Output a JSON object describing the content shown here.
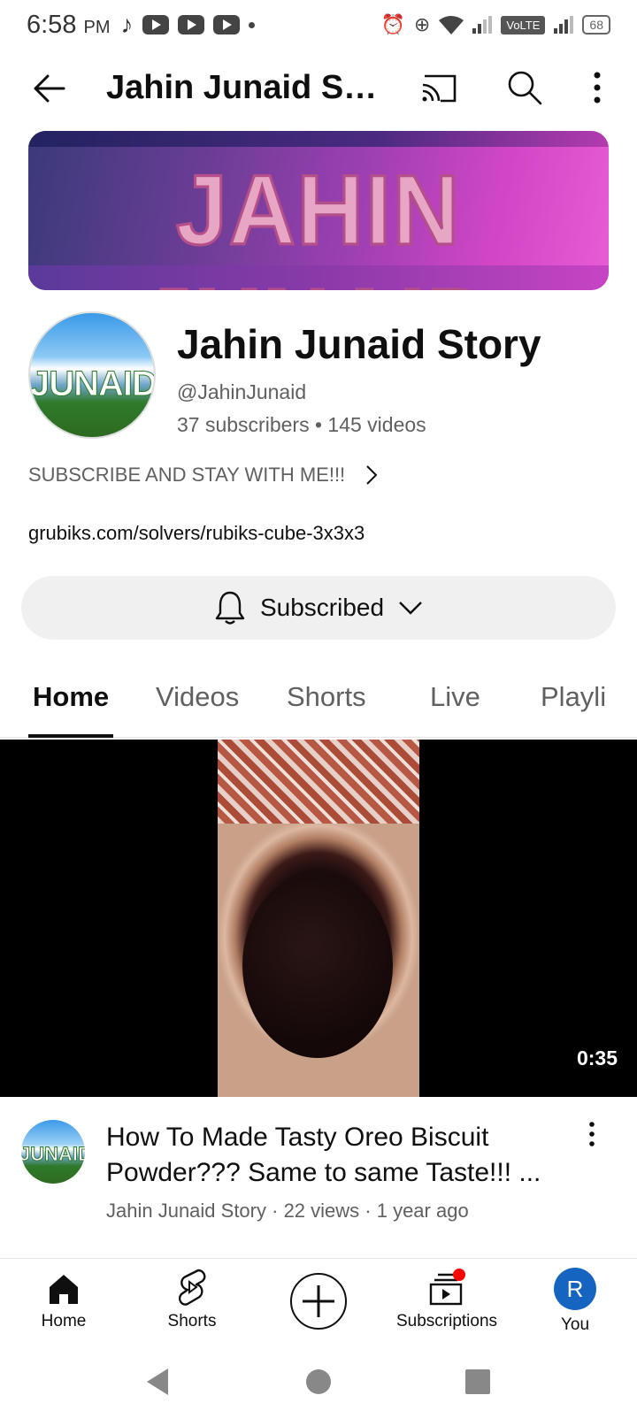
{
  "status_bar": {
    "time": "6:58",
    "ampm": "PM",
    "network": "VoLTE",
    "battery": "68"
  },
  "app_bar": {
    "title": "Jahin Junaid St..."
  },
  "banner": {
    "text": "JAHIN JUNAID"
  },
  "channel": {
    "avatar_text": "JUNAID",
    "name": "Jahin Junaid Story",
    "handle": "@JahinJunaid",
    "subscribers": "37 subscribers",
    "videos": "145 videos",
    "description": "SUBSCRIBE AND STAY WITH ME!!!",
    "link": "grubiks.com/solvers/rubiks-cube-3x3x3",
    "subscribe_label": "Subscribed"
  },
  "tabs": [
    {
      "label": "Home",
      "active": true
    },
    {
      "label": "Videos",
      "active": false
    },
    {
      "label": "Shorts",
      "active": false
    },
    {
      "label": "Live",
      "active": false
    },
    {
      "label": "Playli",
      "active": false
    }
  ],
  "video": {
    "duration": "0:35",
    "title": "How To Made Tasty Oreo Biscuit Powder??? Same to same Taste!!! ...",
    "channel": "Jahin Junaid Story",
    "views": "22 views",
    "age": "1 year ago",
    "avatar_text": "JUNAID"
  },
  "bottom_nav": {
    "items": [
      {
        "label": "Home",
        "icon": "home-icon"
      },
      {
        "label": "Shorts",
        "icon": "shorts-icon"
      },
      {
        "label": "",
        "icon": "create-icon"
      },
      {
        "label": "Subscriptions",
        "icon": "subscriptions-icon"
      },
      {
        "label": "You",
        "icon": "avatar"
      }
    ],
    "you_initial": "R"
  },
  "colors": {
    "accent_red": "#ff0000",
    "you_avatar": "#1565c0",
    "pill_bg": "#f0f0f0"
  }
}
